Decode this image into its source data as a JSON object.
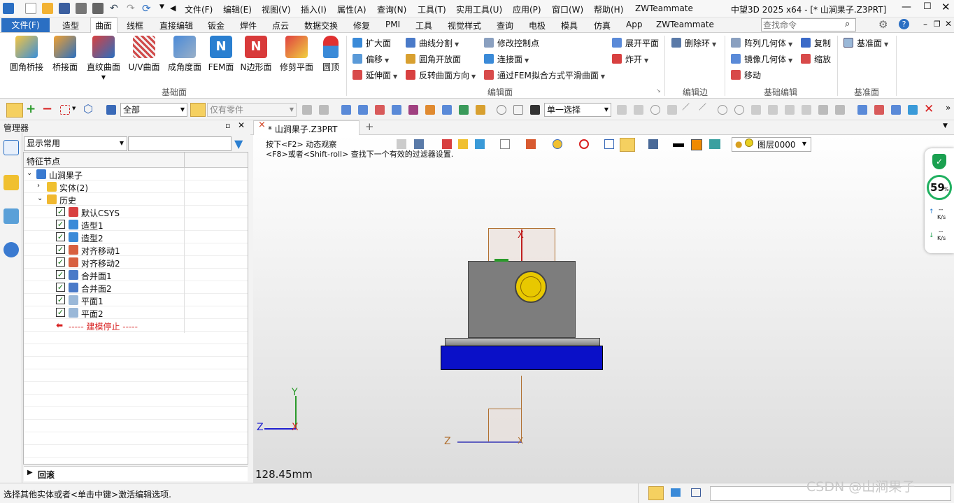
{
  "titlebar": {
    "app_title": "中望3D 2025 x64 - [* 山涧果子.Z3PRT]",
    "menus": [
      "文件(F)",
      "编辑(E)",
      "视图(V)",
      "插入(I)",
      "属性(A)",
      "查询(N)",
      "工具(T)",
      "实用工具(U)",
      "应用(P)",
      "窗口(W)",
      "帮助(H)",
      "ZWTeammate"
    ]
  },
  "ribbon_tabs": {
    "file": "文件(F)",
    "tabs": [
      "造型",
      "曲面",
      "线框",
      "直接编辑",
      "钣金",
      "焊件",
      "点云",
      "数据交换",
      "修复",
      "PMI",
      "工具",
      "视觉样式",
      "查询",
      "电极",
      "模具",
      "仿真",
      "App",
      "ZWTeammate"
    ],
    "active": "曲面",
    "search_placeholder": "查找命令"
  },
  "ribbon": {
    "big_buttons": [
      {
        "label": "圆角桥接",
        "icon": "fillet-bridge-icon"
      },
      {
        "label": "桥接面",
        "icon": "bridge-surface-icon"
      },
      {
        "label": "直纹曲面",
        "icon": "ruled-surface-icon"
      },
      {
        "label": "U/V曲面",
        "icon": "uv-surface-icon"
      },
      {
        "label": "成角度面",
        "icon": "angled-face-icon"
      },
      {
        "label": "FEM面",
        "icon": "fem-face-icon"
      },
      {
        "label": "N边形面",
        "icon": "n-sided-face-icon"
      },
      {
        "label": "修剪平面",
        "icon": "trim-plane-icon"
      },
      {
        "label": "圆顶",
        "icon": "dome-icon"
      }
    ],
    "group_basic_face": "基础面",
    "edit_col1": [
      "扩大面",
      "偏移",
      "延伸面"
    ],
    "edit_col2": [
      "曲线分割",
      "圆角开放面",
      "反转曲面方向"
    ],
    "edit_col3": [
      "修改控制点",
      "连接面",
      "通过FEM拟合方式平滑曲面"
    ],
    "edit_col4": [
      "展开平面",
      "炸开"
    ],
    "group_edit_face": "编辑面",
    "edge_btn": "删除环",
    "group_edit_edge": "编辑边",
    "basic_edit_col1": [
      "阵列几何体",
      "镜像几何体",
      "移动"
    ],
    "basic_edit_col2": [
      "复制",
      "缩放"
    ],
    "group_basic_edit": "基础编辑",
    "datum_btn": "基准面",
    "group_datum": "基准面"
  },
  "toolbar2": {
    "filter_all": "全部",
    "filter_parts": "仅有零件",
    "selection_mode": "单一选择"
  },
  "manager": {
    "title": "管理器",
    "display_combo": "显示常用",
    "column_header": "特征节点",
    "tree": [
      {
        "label": "山涧果子",
        "indent": 0,
        "expand": "v",
        "icon": "assembly-icon"
      },
      {
        "label": "实体(2)",
        "indent": 1,
        "expand": ">",
        "icon": "solid-icon"
      },
      {
        "label": "历史",
        "indent": 1,
        "expand": "v",
        "icon": "folder-icon"
      },
      {
        "label": "默认CSYS",
        "indent": 2,
        "check": true,
        "icon": "csys-icon"
      },
      {
        "label": "造型1",
        "indent": 2,
        "check": true,
        "icon": "shape-icon"
      },
      {
        "label": "造型2",
        "indent": 2,
        "check": true,
        "icon": "shape-icon"
      },
      {
        "label": "对齐移动1",
        "indent": 2,
        "check": true,
        "icon": "align-move-icon"
      },
      {
        "label": "对齐移动2",
        "indent": 2,
        "check": true,
        "icon": "align-move-icon"
      },
      {
        "label": "合并面1",
        "indent": 2,
        "check": true,
        "icon": "merge-face-icon"
      },
      {
        "label": "合并面2",
        "indent": 2,
        "check": true,
        "icon": "merge-face-icon"
      },
      {
        "label": "平面1",
        "indent": 2,
        "check": true,
        "icon": "plane-icon"
      },
      {
        "label": "平面2",
        "indent": 2,
        "check": true,
        "icon": "plane-icon"
      }
    ],
    "stop_marker": "----- 建模停止 -----",
    "bottom_section": "回滚"
  },
  "document": {
    "tab_label": "* 山涧果子.Z3PRT",
    "hint_line1": "按下<F2> 动态观察",
    "hint_line2": "<F8>或者<Shift-roll> 查找下一个有效的过滤器设置.",
    "layer": "图层0000",
    "scale_readout": "128.45mm",
    "axis_labels": {
      "y": "Y",
      "z": "Z",
      "x": "X"
    }
  },
  "gauge": {
    "percent": "59",
    "percent_unit": "%",
    "up": "--",
    "up_unit": "K/s",
    "down": "--",
    "down_unit": "K/s"
  },
  "status": {
    "message": "选择其他实体或者<单击中键>激活编辑选项."
  },
  "watermark": "CSDN @山涧果子",
  "colors": {
    "accent": "#2b6fc3",
    "base_blue": "#0a10c8",
    "body_gray": "#7d7d7d",
    "hole_yellow": "#e8c800",
    "orange_swatch": "#f08a00"
  }
}
